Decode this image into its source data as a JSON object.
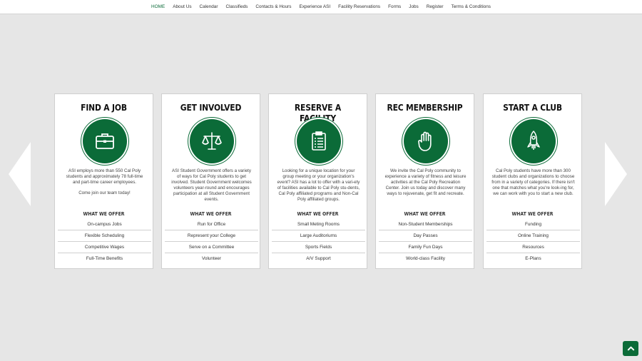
{
  "nav": {
    "items": [
      {
        "label": "HOME",
        "active": true
      },
      {
        "label": "About Us"
      },
      {
        "label": "Calendar"
      },
      {
        "label": "Classifieds"
      },
      {
        "label": "Contacts & Hours"
      },
      {
        "label": "Experience ASI"
      },
      {
        "label": "Facility Reservations"
      },
      {
        "label": "Forms"
      },
      {
        "label": "Jobs"
      },
      {
        "label": "Register"
      },
      {
        "label": "Terms & Conditions"
      }
    ]
  },
  "carousel": {
    "prev_icon": "chevron-left-icon",
    "next_icon": "chevron-right-icon"
  },
  "cards": [
    {
      "title": "FIND A JOB",
      "icon": "briefcase-icon",
      "desc": [
        "ASI employs more than 550 Cal Poly students and approximately 78 full-time and part-time career employees.",
        "Come join our team today!"
      ],
      "offer_heading": "WHAT WE OFFER",
      "offers": [
        "On-campus Jobs",
        "Flexible Scheduling",
        "Competitive Wages",
        "Full-Time Benefits"
      ]
    },
    {
      "title": "GET INVOLVED",
      "icon": "scales-icon",
      "desc": [
        "ASI Student Government offers a variety of ways for Cal Poly students to get involved. Student Government welcomes volunteers year-round and encourages participation at all Student Government events."
      ],
      "offer_heading": "WHAT WE OFFER",
      "offers": [
        "Run for Office",
        "Represent your College",
        "Serve on a Committee",
        "Volunteer"
      ]
    },
    {
      "title": "RESERVE A FACILITY",
      "icon": "clipboard-icon",
      "desc": [
        "Looking for a unique location for your group meeting or your organization's event? ASI has a lot to offer with a vari-ety of facilities available to Cal Poly stu-dents, Cal Poly affiliated programs and Non-Cal Poly affiliated groups."
      ],
      "offer_heading": "WHAT WE OFFER",
      "offers": [
        "Small Meting Rooms",
        "Large Auditoriums",
        "Sports Fields",
        "A/V Support"
      ]
    },
    {
      "title": "REC MEMBERSHIP",
      "icon": "hand-icon",
      "desc": [
        "We invite the Cal Poly community to experience a variety of fitness and leisure activities at the Cal Poly Recreation Center. Join us today and discover many ways to rejuvenate, get fit and recreate."
      ],
      "offer_heading": "WHAT WE OFFER",
      "offers": [
        "Non-Student Memberships",
        "Day Passes",
        "Family Fun Days",
        "World-class Facility"
      ]
    },
    {
      "title": "START A CLUB",
      "icon": "rocket-icon",
      "desc": [
        "Cal Poly students have more than 300 student clubs and organizations to choose from in a variety of categories. If there isn't one that matches what you're look-ing for, we can work with you to start a new club."
      ],
      "offer_heading": "WHAT WE OFFER",
      "offers": [
        "Funding",
        "Online Training",
        "Resources",
        "E-Plans"
      ]
    }
  ],
  "scroll_top": {
    "icon": "chevron-up-icon"
  },
  "colors": {
    "accent": "#0b6b38",
    "background": "#e6e6e6"
  }
}
